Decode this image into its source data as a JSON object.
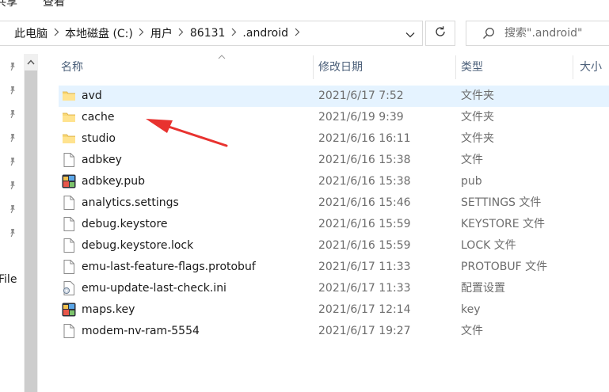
{
  "ribbon": {
    "tabs": [
      "共享",
      "查看"
    ]
  },
  "address_bar": {
    "crumbs": [
      "此电脑",
      "本地磁盘 (C:)",
      "用户",
      "86131",
      ".android"
    ]
  },
  "search": {
    "placeholder": "搜索\".android\""
  },
  "nav_pane": {
    "partial_label": "File"
  },
  "columns": {
    "name": "名称",
    "date": "修改日期",
    "type": "类型",
    "size": "大小"
  },
  "files": [
    {
      "name": "avd",
      "date": "2021/6/17 7:52",
      "type": "文件夹",
      "icon": "folder-icon",
      "selected": true
    },
    {
      "name": "cache",
      "date": "2021/6/19 9:39",
      "type": "文件夹",
      "icon": "folder-icon"
    },
    {
      "name": "studio",
      "date": "2021/6/16 16:11",
      "type": "文件夹",
      "icon": "folder-icon"
    },
    {
      "name": "adbkey",
      "date": "2021/6/16 15:38",
      "type": "文件",
      "icon": "file-icon"
    },
    {
      "name": "adbkey.pub",
      "date": "2021/6/16 15:38",
      "type": "pub",
      "icon": "image-app-icon"
    },
    {
      "name": "analytics.settings",
      "date": "2021/6/16 15:46",
      "type": "SETTINGS 文件",
      "icon": "file-icon"
    },
    {
      "name": "debug.keystore",
      "date": "2021/6/16 15:59",
      "type": "KEYSTORE 文件",
      "icon": "file-icon"
    },
    {
      "name": "debug.keystore.lock",
      "date": "2021/6/16 15:59",
      "type": "LOCK 文件",
      "icon": "file-icon"
    },
    {
      "name": "emu-last-feature-flags.protobuf",
      "date": "2021/6/17 11:33",
      "type": "PROTOBUF 文件",
      "icon": "file-icon"
    },
    {
      "name": "emu-update-last-check.ini",
      "date": "2021/6/17 11:33",
      "type": "配置设置",
      "icon": "settings-file-icon"
    },
    {
      "name": "maps.key",
      "date": "2021/6/17 12:14",
      "type": "key",
      "icon": "image-app-icon"
    },
    {
      "name": "modem-nv-ram-5554",
      "date": "2021/6/17 19:27",
      "type": "文件",
      "icon": "file-icon"
    }
  ],
  "colors": {
    "selection": "#e5f3ff",
    "folder": "#f8d775",
    "header_text": "#4c607a",
    "annotation_arrow": "#e8322f"
  }
}
